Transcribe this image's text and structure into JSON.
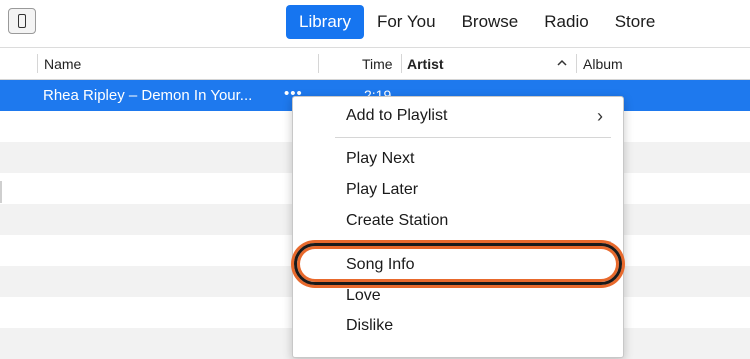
{
  "toolbar": {
    "tabs": [
      {
        "label": "Library",
        "active": true
      },
      {
        "label": "For You",
        "active": false
      },
      {
        "label": "Browse",
        "active": false
      },
      {
        "label": "Radio",
        "active": false
      },
      {
        "label": "Store",
        "active": false
      }
    ],
    "accent": "#1675f0"
  },
  "table": {
    "columns": {
      "name": "Name",
      "time": "Time",
      "artist": "Artist",
      "album": "Album"
    },
    "sort": {
      "column": "artist",
      "direction": "ascending",
      "icon": "chevron-up-icon"
    },
    "rows": [
      {
        "name": "Rhea Ripley – Demon In Your...",
        "time": "2:19",
        "selected": true,
        "more": "•••"
      }
    ],
    "selection_color": "#1e79ee"
  },
  "context_menu": {
    "items": {
      "add_to_playlist": "Add to Playlist",
      "play_next": "Play Next",
      "play_later": "Play Later",
      "create_station": "Create Station",
      "song_info": "Song Info",
      "love": "Love",
      "dislike": "Dislike"
    },
    "submenu_icon": "chevron-right-icon",
    "highlighted_item": "Song Info",
    "highlight_color": "#e8692c"
  }
}
